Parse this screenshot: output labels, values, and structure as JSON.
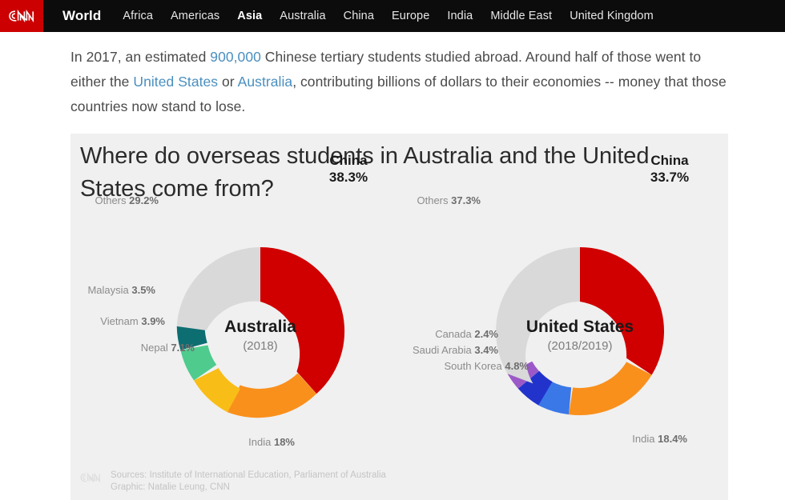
{
  "nav": {
    "logo": "cnn-logo",
    "section": "World",
    "items": [
      {
        "label": "Africa",
        "active": false
      },
      {
        "label": "Americas",
        "active": false
      },
      {
        "label": "Asia",
        "active": true
      },
      {
        "label": "Australia",
        "active": false
      },
      {
        "label": "China",
        "active": false
      },
      {
        "label": "Europe",
        "active": false
      },
      {
        "label": "India",
        "active": false
      },
      {
        "label": "Middle East",
        "active": false
      },
      {
        "label": "United Kingdom",
        "active": false
      }
    ]
  },
  "article": {
    "paragraph": {
      "p1": "In 2017, an estimated ",
      "link_900k": "900,000",
      "p2": " Chinese tertiary students studied abroad. Around half of those went to either the ",
      "link_us": "United States",
      "p3": " or ",
      "link_au": "Australia",
      "p4": ", contributing billions of dollars to their economies -- money that those countries now stand to lose."
    }
  },
  "chart_data": {
    "type": "pie",
    "title": "Where do overseas students in Australia and the United States come from?",
    "subtitle": "",
    "xlabel": "",
    "ylabel": "",
    "legend_position": "labels-around-donuts",
    "grid": false,
    "donuts": [
      {
        "name": "Australia",
        "center_label": "Australia",
        "year_label": "(2018)",
        "categories": [
          "China",
          "India",
          "Nepal",
          "Vietnam",
          "Malaysia",
          "Others"
        ],
        "values": [
          38.3,
          18.0,
          7.1,
          3.9,
          3.5,
          29.2
        ],
        "labels": [
          "China 38.3%",
          "India 18%",
          "Nepal 7.1%",
          "Vietnam 3.9%",
          "Malaysia 3.5%",
          "Others 29.2%"
        ],
        "value_labels": [
          "38.3%",
          "18%",
          "7.1%",
          "3.9%",
          "3.5%",
          "29.2%"
        ],
        "colors": [
          "#d00000",
          "#f9901c",
          "#f9bd17",
          "#4ecb8d",
          "#0d6e72",
          "#d9d9d9"
        ]
      },
      {
        "name": "United States",
        "center_label": "United States",
        "year_label": "(2018/2019)",
        "categories": [
          "China",
          "India",
          "South Korea",
          "Saudi Arabia",
          "Canada",
          "Others"
        ],
        "values": [
          33.7,
          18.4,
          4.8,
          3.4,
          2.4,
          37.3
        ],
        "labels": [
          "China 33.7%",
          "India 18.4%",
          "South Korea 4.8%",
          "Saudi Arabia 3.4%",
          "Canada 2.4%",
          "Others 37.3%"
        ],
        "value_labels": [
          "33.7%",
          "18.4%",
          "4.8%",
          "3.4%",
          "2.4%",
          "37.3%"
        ],
        "colors": [
          "#d00000",
          "#f9901c",
          "#3a78e8",
          "#2233cc",
          "#9b59c7",
          "#d9d9d9"
        ]
      }
    ]
  },
  "panel": {
    "au": {
      "china_name": "China",
      "china_val": "38.3%",
      "others_name": "Others",
      "others_val": "29.2%",
      "malaysia_name": "Malaysia",
      "malaysia_val": "3.5%",
      "vietnam_name": "Vietnam",
      "vietnam_val": "3.9%",
      "nepal_name": "Nepal",
      "nepal_val": "7.1%",
      "india_name": "India",
      "india_val": "18%",
      "center": "Australia",
      "year": "(2018)"
    },
    "us": {
      "china_name": "China",
      "china_val": "33.7%",
      "others_name": "Others",
      "others_val": "37.3%",
      "canada_name": "Canada",
      "canada_val": "2.4%",
      "saudi_name": "Saudi Arabia",
      "saudi_val": "3.4%",
      "korea_name": "South Korea",
      "korea_val": "4.8%",
      "india_name": "India",
      "india_val": "18.4%",
      "center": "United States",
      "year": "(2018/2019)"
    },
    "footer": {
      "sources": "Sources: Institute of International Education, Parliament of Australia",
      "graphic": "Graphic: Natalie Leung, CNN"
    }
  },
  "colors": {
    "brand_red": "#cc0000",
    "nav_bg": "#0c0c0c",
    "panel_bg": "#f0f0f0",
    "link": "#4a8fbf",
    "china": "#d00000",
    "india": "#f9901c",
    "others": "#d9d9d9"
  }
}
